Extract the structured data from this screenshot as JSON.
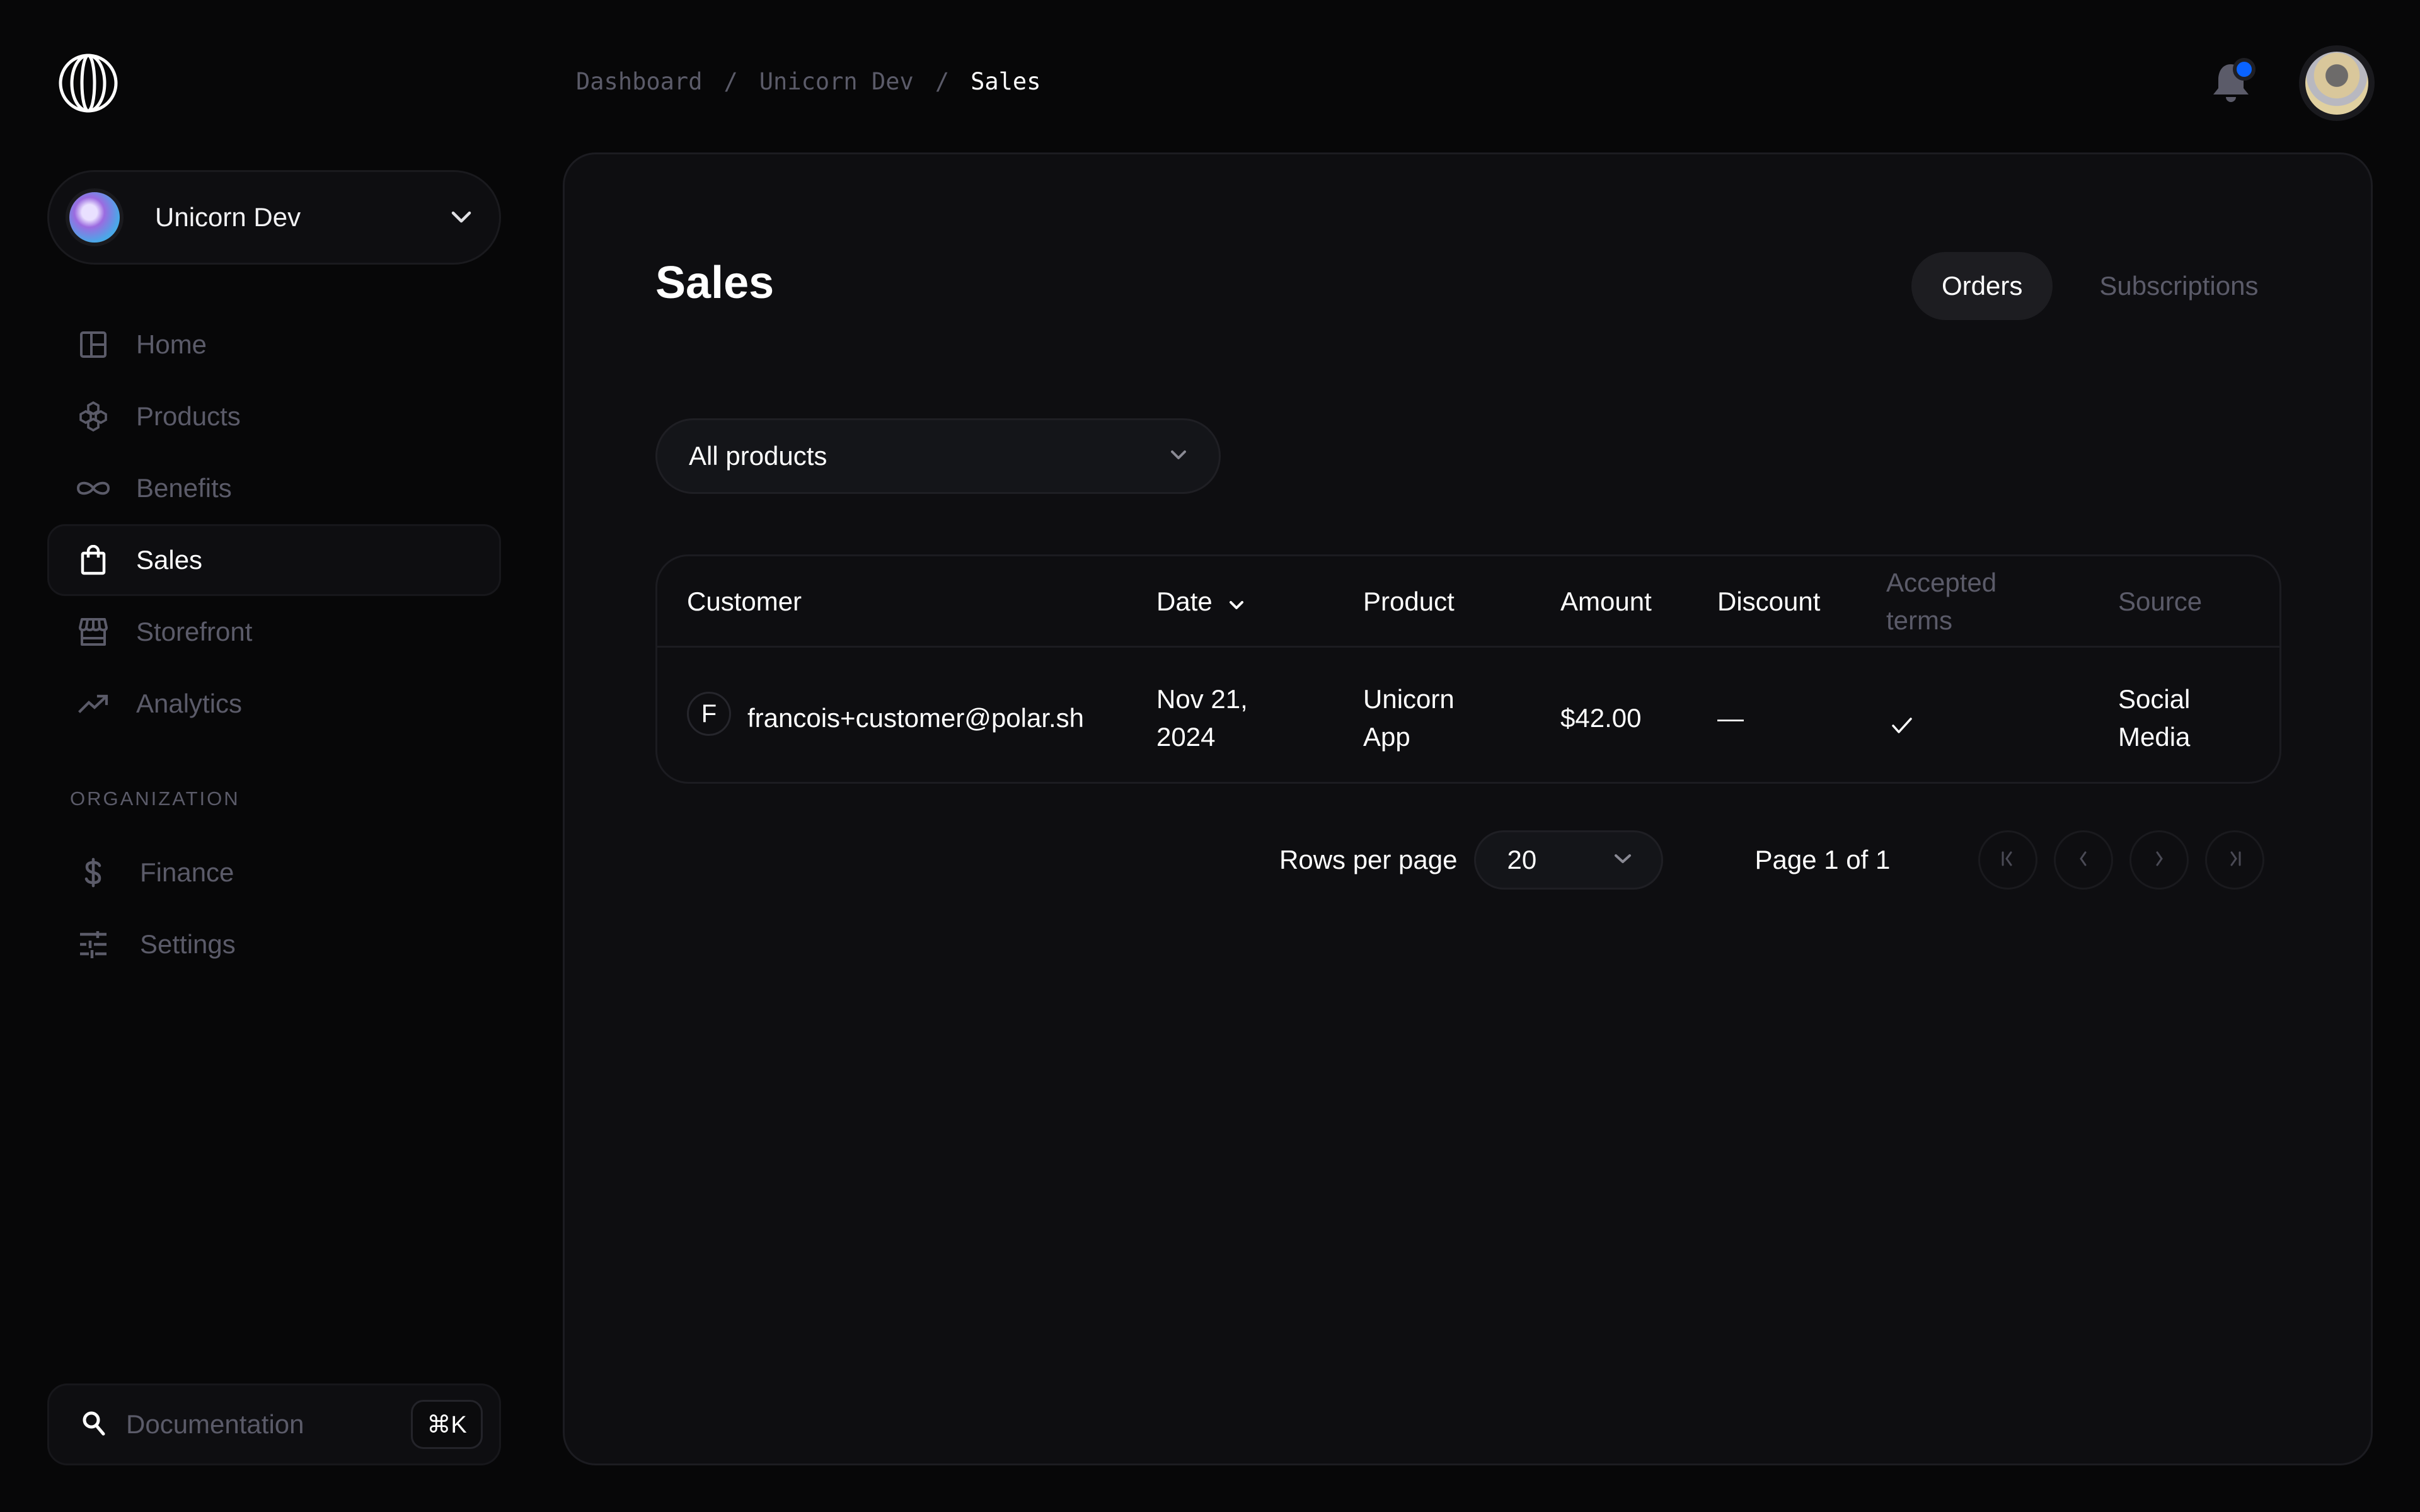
{
  "app": {
    "logo": "polar-logo-icon"
  },
  "org_switcher": {
    "name": "Unicorn Dev",
    "avatar": "unicorn-avatar"
  },
  "sidebar": {
    "items": [
      {
        "label": "Home",
        "icon": "layout-icon",
        "active": false
      },
      {
        "label": "Products",
        "icon": "hive-icon",
        "active": false
      },
      {
        "label": "Benefits",
        "icon": "infinity-icon",
        "active": false
      },
      {
        "label": "Sales",
        "icon": "shopping-bag-icon",
        "active": true
      },
      {
        "label": "Storefront",
        "icon": "storefront-icon",
        "active": false
      },
      {
        "label": "Analytics",
        "icon": "trending-up-icon",
        "active": false
      }
    ],
    "section_label": "ORGANIZATION",
    "org_items": [
      {
        "label": "Finance",
        "icon": "dollar-icon"
      },
      {
        "label": "Settings",
        "icon": "tune-icon"
      }
    ],
    "docs": {
      "label": "Documentation",
      "shortcut": "⌘K"
    }
  },
  "breadcrumb": {
    "items": [
      "Dashboard",
      "Unicorn Dev",
      "Sales"
    ],
    "separator": "/"
  },
  "header": {
    "notifications_unread": true,
    "accent": "#0a63ff"
  },
  "page": {
    "title": "Sales",
    "tabs": [
      {
        "label": "Orders",
        "active": true
      },
      {
        "label": "Subscriptions",
        "active": false
      }
    ],
    "product_filter": {
      "value": "All products"
    }
  },
  "table": {
    "columns": [
      {
        "label": "Customer"
      },
      {
        "label": "Date",
        "sorted": "desc"
      },
      {
        "label": "Product"
      },
      {
        "label": "Amount"
      },
      {
        "label": "Discount"
      },
      {
        "label": "Accepted terms"
      },
      {
        "label": "Source"
      }
    ],
    "rows": [
      {
        "initial": "F",
        "customer": "francois+customer@polar.sh",
        "date_line1": "Nov 21,",
        "date_line2": "2024",
        "product_line1": "Unicorn",
        "product_line2": "App",
        "amount": "$42.00",
        "discount": "—",
        "accepted_terms": true,
        "source_line1": "Social",
        "source_line2": "Media"
      }
    ]
  },
  "pagination": {
    "rows_per_page_label": "Rows per page",
    "rows_per_page": "20",
    "page_info": "Page 1 of 1",
    "current_page": 1,
    "total_pages": 1
  }
}
